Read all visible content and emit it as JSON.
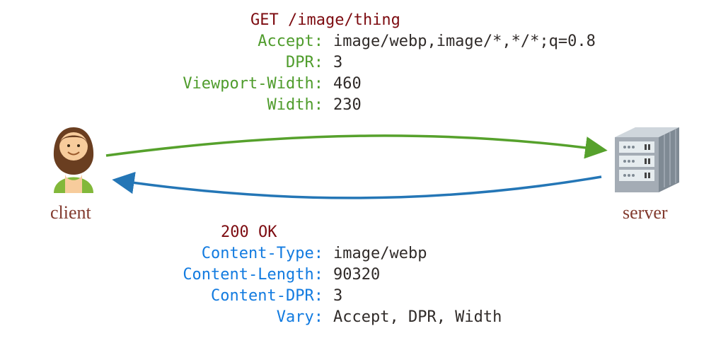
{
  "request": {
    "line": "GET /image/thing",
    "headers": [
      {
        "name": "Accept",
        "value": "image/webp,image/*,*/*;q=0.8"
      },
      {
        "name": "DPR",
        "value": "3"
      },
      {
        "name": "Viewport-Width",
        "value": "460"
      },
      {
        "name": "Width",
        "value": "230"
      }
    ]
  },
  "response": {
    "status": "200 OK",
    "headers": [
      {
        "name": "Content-Type",
        "value": "image/webp"
      },
      {
        "name": "Content-Length",
        "value": "90320"
      },
      {
        "name": "Content-DPR",
        "value": "3"
      },
      {
        "name": "Vary",
        "value": "Accept, DPR, Width"
      }
    ]
  },
  "client_label": "client",
  "server_label": "server",
  "colors": {
    "request_key": "#4f9c2c",
    "request_line": "#7d0c11",
    "response_key": "#127be0",
    "value": "#302b29",
    "caption": "#823a2e",
    "arrow_req": "#56a12c",
    "arrow_res": "#2476b6"
  }
}
